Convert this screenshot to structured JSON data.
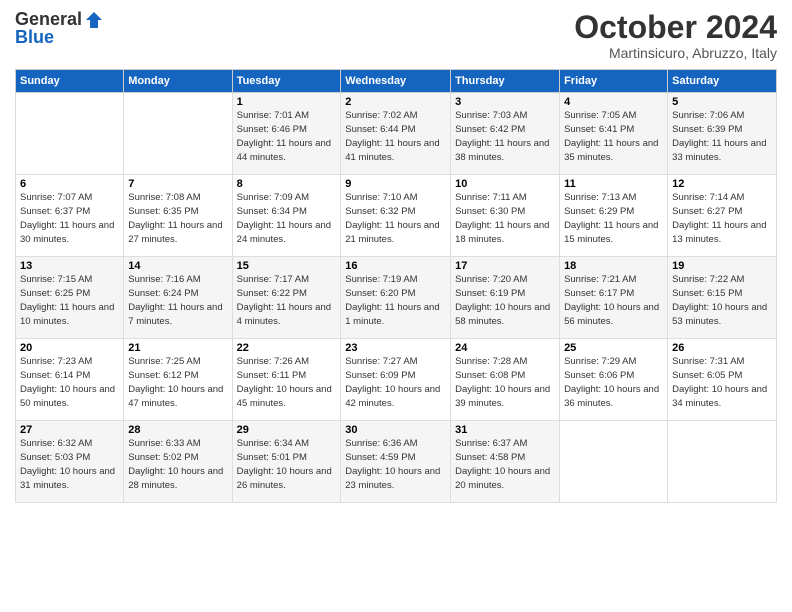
{
  "header": {
    "logo_general": "General",
    "logo_blue": "Blue",
    "month_title": "October 2024",
    "subtitle": "Martinsicuro, Abruzzo, Italy"
  },
  "days_of_week": [
    "Sunday",
    "Monday",
    "Tuesday",
    "Wednesday",
    "Thursday",
    "Friday",
    "Saturday"
  ],
  "weeks": [
    [
      {
        "day": "",
        "sunrise": "",
        "sunset": "",
        "daylight": ""
      },
      {
        "day": "",
        "sunrise": "",
        "sunset": "",
        "daylight": ""
      },
      {
        "day": "1",
        "sunrise": "Sunrise: 7:01 AM",
        "sunset": "Sunset: 6:46 PM",
        "daylight": "Daylight: 11 hours and 44 minutes."
      },
      {
        "day": "2",
        "sunrise": "Sunrise: 7:02 AM",
        "sunset": "Sunset: 6:44 PM",
        "daylight": "Daylight: 11 hours and 41 minutes."
      },
      {
        "day": "3",
        "sunrise": "Sunrise: 7:03 AM",
        "sunset": "Sunset: 6:42 PM",
        "daylight": "Daylight: 11 hours and 38 minutes."
      },
      {
        "day": "4",
        "sunrise": "Sunrise: 7:05 AM",
        "sunset": "Sunset: 6:41 PM",
        "daylight": "Daylight: 11 hours and 35 minutes."
      },
      {
        "day": "5",
        "sunrise": "Sunrise: 7:06 AM",
        "sunset": "Sunset: 6:39 PM",
        "daylight": "Daylight: 11 hours and 33 minutes."
      }
    ],
    [
      {
        "day": "6",
        "sunrise": "Sunrise: 7:07 AM",
        "sunset": "Sunset: 6:37 PM",
        "daylight": "Daylight: 11 hours and 30 minutes."
      },
      {
        "day": "7",
        "sunrise": "Sunrise: 7:08 AM",
        "sunset": "Sunset: 6:35 PM",
        "daylight": "Daylight: 11 hours and 27 minutes."
      },
      {
        "day": "8",
        "sunrise": "Sunrise: 7:09 AM",
        "sunset": "Sunset: 6:34 PM",
        "daylight": "Daylight: 11 hours and 24 minutes."
      },
      {
        "day": "9",
        "sunrise": "Sunrise: 7:10 AM",
        "sunset": "Sunset: 6:32 PM",
        "daylight": "Daylight: 11 hours and 21 minutes."
      },
      {
        "day": "10",
        "sunrise": "Sunrise: 7:11 AM",
        "sunset": "Sunset: 6:30 PM",
        "daylight": "Daylight: 11 hours and 18 minutes."
      },
      {
        "day": "11",
        "sunrise": "Sunrise: 7:13 AM",
        "sunset": "Sunset: 6:29 PM",
        "daylight": "Daylight: 11 hours and 15 minutes."
      },
      {
        "day": "12",
        "sunrise": "Sunrise: 7:14 AM",
        "sunset": "Sunset: 6:27 PM",
        "daylight": "Daylight: 11 hours and 13 minutes."
      }
    ],
    [
      {
        "day": "13",
        "sunrise": "Sunrise: 7:15 AM",
        "sunset": "Sunset: 6:25 PM",
        "daylight": "Daylight: 11 hours and 10 minutes."
      },
      {
        "day": "14",
        "sunrise": "Sunrise: 7:16 AM",
        "sunset": "Sunset: 6:24 PM",
        "daylight": "Daylight: 11 hours and 7 minutes."
      },
      {
        "day": "15",
        "sunrise": "Sunrise: 7:17 AM",
        "sunset": "Sunset: 6:22 PM",
        "daylight": "Daylight: 11 hours and 4 minutes."
      },
      {
        "day": "16",
        "sunrise": "Sunrise: 7:19 AM",
        "sunset": "Sunset: 6:20 PM",
        "daylight": "Daylight: 11 hours and 1 minute."
      },
      {
        "day": "17",
        "sunrise": "Sunrise: 7:20 AM",
        "sunset": "Sunset: 6:19 PM",
        "daylight": "Daylight: 10 hours and 58 minutes."
      },
      {
        "day": "18",
        "sunrise": "Sunrise: 7:21 AM",
        "sunset": "Sunset: 6:17 PM",
        "daylight": "Daylight: 10 hours and 56 minutes."
      },
      {
        "day": "19",
        "sunrise": "Sunrise: 7:22 AM",
        "sunset": "Sunset: 6:15 PM",
        "daylight": "Daylight: 10 hours and 53 minutes."
      }
    ],
    [
      {
        "day": "20",
        "sunrise": "Sunrise: 7:23 AM",
        "sunset": "Sunset: 6:14 PM",
        "daylight": "Daylight: 10 hours and 50 minutes."
      },
      {
        "day": "21",
        "sunrise": "Sunrise: 7:25 AM",
        "sunset": "Sunset: 6:12 PM",
        "daylight": "Daylight: 10 hours and 47 minutes."
      },
      {
        "day": "22",
        "sunrise": "Sunrise: 7:26 AM",
        "sunset": "Sunset: 6:11 PM",
        "daylight": "Daylight: 10 hours and 45 minutes."
      },
      {
        "day": "23",
        "sunrise": "Sunrise: 7:27 AM",
        "sunset": "Sunset: 6:09 PM",
        "daylight": "Daylight: 10 hours and 42 minutes."
      },
      {
        "day": "24",
        "sunrise": "Sunrise: 7:28 AM",
        "sunset": "Sunset: 6:08 PM",
        "daylight": "Daylight: 10 hours and 39 minutes."
      },
      {
        "day": "25",
        "sunrise": "Sunrise: 7:29 AM",
        "sunset": "Sunset: 6:06 PM",
        "daylight": "Daylight: 10 hours and 36 minutes."
      },
      {
        "day": "26",
        "sunrise": "Sunrise: 7:31 AM",
        "sunset": "Sunset: 6:05 PM",
        "daylight": "Daylight: 10 hours and 34 minutes."
      }
    ],
    [
      {
        "day": "27",
        "sunrise": "Sunrise: 6:32 AM",
        "sunset": "Sunset: 5:03 PM",
        "daylight": "Daylight: 10 hours and 31 minutes."
      },
      {
        "day": "28",
        "sunrise": "Sunrise: 6:33 AM",
        "sunset": "Sunset: 5:02 PM",
        "daylight": "Daylight: 10 hours and 28 minutes."
      },
      {
        "day": "29",
        "sunrise": "Sunrise: 6:34 AM",
        "sunset": "Sunset: 5:01 PM",
        "daylight": "Daylight: 10 hours and 26 minutes."
      },
      {
        "day": "30",
        "sunrise": "Sunrise: 6:36 AM",
        "sunset": "Sunset: 4:59 PM",
        "daylight": "Daylight: 10 hours and 23 minutes."
      },
      {
        "day": "31",
        "sunrise": "Sunrise: 6:37 AM",
        "sunset": "Sunset: 4:58 PM",
        "daylight": "Daylight: 10 hours and 20 minutes."
      },
      {
        "day": "",
        "sunrise": "",
        "sunset": "",
        "daylight": ""
      },
      {
        "day": "",
        "sunrise": "",
        "sunset": "",
        "daylight": ""
      }
    ]
  ]
}
